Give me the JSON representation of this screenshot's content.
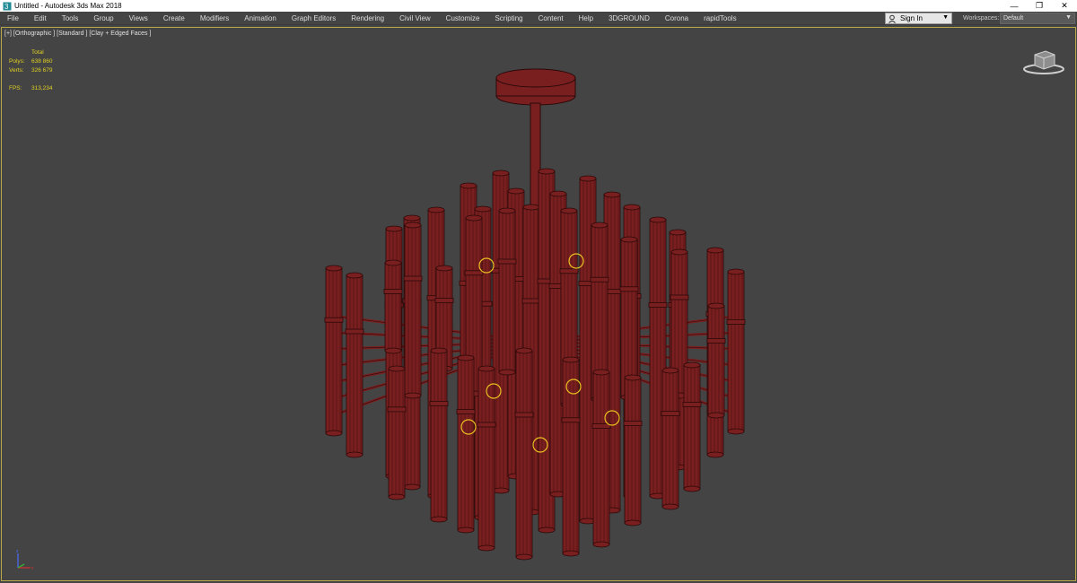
{
  "window": {
    "title": "Untitled - Autodesk 3ds Max 2018",
    "icon": "3dsmax-app-icon",
    "controls": {
      "minimize": "—",
      "restore": "❐",
      "close": "✕"
    }
  },
  "menu": {
    "items": [
      "File",
      "Edit",
      "Tools",
      "Group",
      "Views",
      "Create",
      "Modifiers",
      "Animation",
      "Graph Editors",
      "Rendering",
      "Civil View",
      "Customize",
      "Scripting",
      "Content",
      "Help",
      "3DGROUND",
      "Corona",
      "rapidTools"
    ],
    "sign_in": "Sign In",
    "workspaces_label": "Workspaces:",
    "workspace_value": "Default"
  },
  "viewport": {
    "label": "[+] [Orthographic ] [Standard ] [Clay + Edged Faces ]",
    "stats": {
      "header": "Total",
      "polys_label": "Polys:",
      "polys_value": "638 860",
      "verts_label": "Verts:",
      "verts_value": "326 679",
      "fps_label": "FPS:",
      "fps_value": "313,234"
    },
    "model_color": "#7a1f1f",
    "wire_color": "#2a0808",
    "bulb_color": "#e8c020"
  }
}
